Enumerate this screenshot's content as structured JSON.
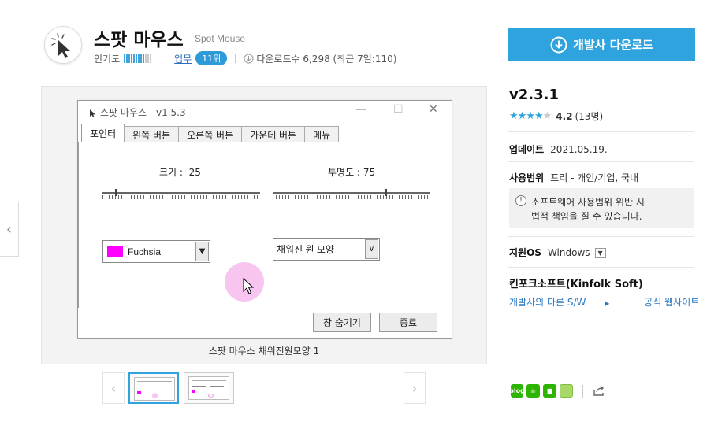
{
  "header": {
    "title": "스팟 마우스",
    "subtitle": "Spot Mouse",
    "popularity_label": "인기도",
    "popularity_level": 0.75,
    "category_link": "업무",
    "rank": "11위",
    "downloads": "다운로드수 6,298 (최근 7일:110)"
  },
  "download_button": {
    "label": "개발사 다운로드"
  },
  "screenshot": {
    "window_title": "스팟 마우스 - v1.5.3",
    "tabs": [
      "포인터",
      "왼쪽 버튼",
      "오른쪽 버튼",
      "가운데 버튼",
      "메뉴"
    ],
    "size_label": "크기 :",
    "size_value": "25",
    "opacity_label": "투명도 :",
    "opacity_value": "75",
    "size_level": 0.08,
    "opacity_level": 0.72,
    "color_value": "Fuchsia",
    "color_swatch": "#ff00ff",
    "shape_value": "채워진 원 모양",
    "hide_button": "창 숨기기",
    "exit_button": "종료",
    "caption": "스팟 마우스 채워진원모양 1"
  },
  "info": {
    "version": "v2.3.1",
    "rating_value": "4.2",
    "rating_count": "(13명)",
    "update_label": "업데이트",
    "update_date": "2021.05.19.",
    "license_label": "사용범위",
    "license_value": "프리 - 개인/기업, 국내",
    "notice_line1": "소프트웨어 사용범위 위반 시",
    "notice_line2": "법적 책임을 질 수 있습니다.",
    "os_label": "지원OS",
    "os_value": "Windows",
    "developer": "킨포크소프트(Kinfolk Soft)",
    "dev_link_other": "개발사의 다른 S/W",
    "dev_link_site": "공식 웹사이트"
  },
  "share": {
    "blog_label": "blog"
  },
  "colors": {
    "accent": "#2ea3dd",
    "link": "#2a7ac2",
    "swatch": "#ff00ff"
  }
}
